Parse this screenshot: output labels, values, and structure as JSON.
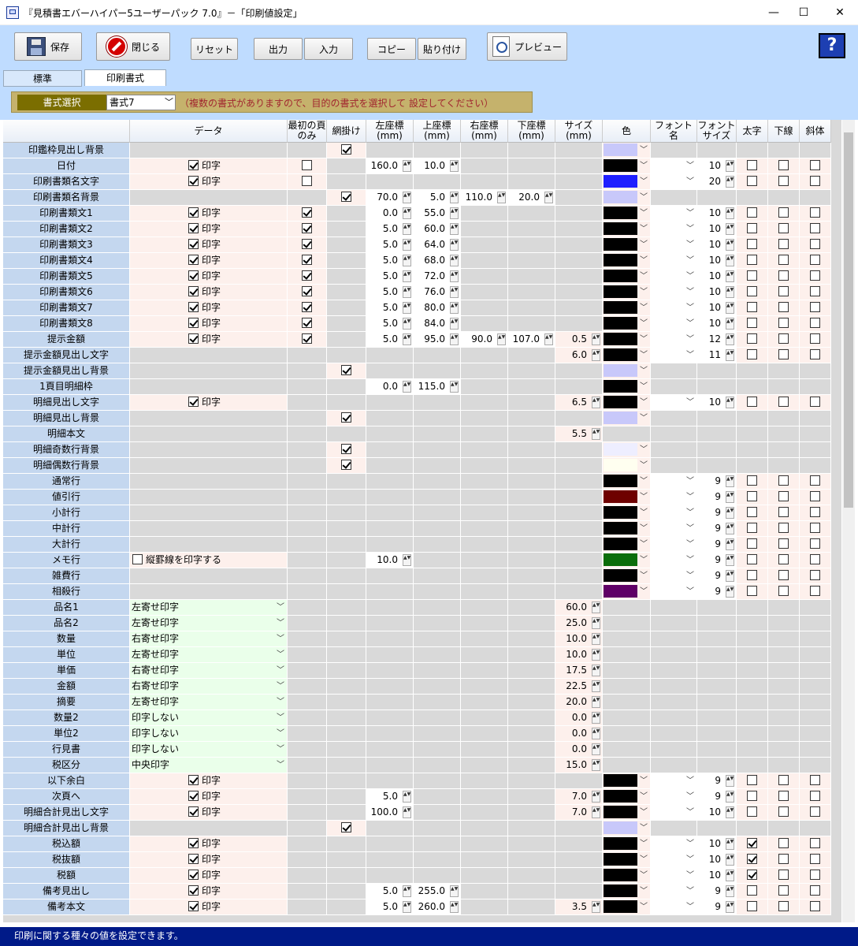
{
  "window": {
    "title": "『見積書エバーハイパー5ユーザーパック 7.0』－「印刷値設定」",
    "minimize": "—",
    "maximize": "☐",
    "close": "✕"
  },
  "toolbar": {
    "save": "保存",
    "close": "閉じる",
    "reset": "リセット",
    "output": "出力",
    "input": "入力",
    "copy": "コピー",
    "paste": "貼り付け",
    "preview": "プレビュー",
    "help": "?"
  },
  "tabs": [
    {
      "label": "標準"
    },
    {
      "label": "印刷書式"
    }
  ],
  "format": {
    "label": "書式選択",
    "selected": "書式7",
    "note": "（複数の書式がありますので、目的の書式を選択して 設定してください）"
  },
  "colors": {
    "black": "#000000",
    "blue": "#1f1fff",
    "lavender": "#c8c8fa",
    "maroon": "#6e0000",
    "green": "#0b6e0b",
    "purple": "#5f0066",
    "paleblue": "#eeeeff",
    "paleyellow": "#fffff0"
  },
  "headers": {
    "data": "データ",
    "first_page": "最初の頁のみ",
    "shading": "網掛け",
    "left": "左座標(mm)",
    "top": "上座標(mm)",
    "right": "右座標(mm)",
    "bottom": "下座標(mm)",
    "size": "サイズ(mm)",
    "color": "色",
    "font": "フォント名",
    "fontsize": "フォントサイズ",
    "bold": "太字",
    "underline": "下線",
    "italic": "斜体"
  },
  "grid_rows": [
    {
      "label": "印鑑枠見出し背景",
      "mode": "shade",
      "color": "lavender"
    },
    {
      "label": "日付",
      "check": "印字",
      "check_on": true,
      "first": false,
      "left": "160.0",
      "top": "10.0",
      "color": "black",
      "font": true,
      "fs": "10",
      "bold": false
    },
    {
      "label": "印刷書類名文字",
      "check": "印字",
      "check_on": true,
      "first": false,
      "color": "blue",
      "font": true,
      "fs": "20",
      "bold": false
    },
    {
      "label": "印刷書類名背景",
      "mode": "shade",
      "left": "70.0",
      "top": "5.0",
      "right": "110.0",
      "bottom": "20.0",
      "color": "lavender"
    },
    {
      "label": "印刷書類文1",
      "check": "印字",
      "check_on": true,
      "first": true,
      "left": "0.0",
      "top": "55.0",
      "color": "black",
      "font": true,
      "fs": "10",
      "bold": false
    },
    {
      "label": "印刷書類文2",
      "check": "印字",
      "check_on": true,
      "first": true,
      "left": "5.0",
      "top": "60.0",
      "color": "black",
      "font": true,
      "fs": "10",
      "bold": false
    },
    {
      "label": "印刷書類文3",
      "check": "印字",
      "check_on": true,
      "first": true,
      "left": "5.0",
      "top": "64.0",
      "color": "black",
      "font": true,
      "fs": "10",
      "bold": false
    },
    {
      "label": "印刷書類文4",
      "check": "印字",
      "check_on": true,
      "first": true,
      "left": "5.0",
      "top": "68.0",
      "color": "black",
      "font": true,
      "fs": "10",
      "bold": false
    },
    {
      "label": "印刷書類文5",
      "check": "印字",
      "check_on": true,
      "first": true,
      "left": "5.0",
      "top": "72.0",
      "color": "black",
      "font": true,
      "fs": "10",
      "bold": false
    },
    {
      "label": "印刷書類文6",
      "check": "印字",
      "check_on": true,
      "first": true,
      "left": "5.0",
      "top": "76.0",
      "color": "black",
      "font": true,
      "fs": "10",
      "bold": false
    },
    {
      "label": "印刷書類文7",
      "check": "印字",
      "check_on": true,
      "first": true,
      "left": "5.0",
      "top": "80.0",
      "color": "black",
      "font": true,
      "fs": "10",
      "bold": false
    },
    {
      "label": "印刷書類文8",
      "check": "印字",
      "check_on": true,
      "first": true,
      "left": "5.0",
      "top": "84.0",
      "color": "black",
      "font": true,
      "fs": "10",
      "bold": false
    },
    {
      "label": "提示金額",
      "check": "印字",
      "check_on": true,
      "first": true,
      "left": "5.0",
      "top": "95.0",
      "right": "90.0",
      "bottom": "107.0",
      "size": "0.5",
      "color": "black",
      "font": true,
      "fs": "12",
      "bold": false
    },
    {
      "label": "提示金額見出し文字",
      "size": "6.0",
      "color": "black",
      "font": true,
      "fs": "11",
      "bold": false
    },
    {
      "label": "提示金額見出し背景",
      "mode": "shade",
      "color": "lavender"
    },
    {
      "label": "1頁目明細枠",
      "left": "0.0",
      "top": "115.0",
      "color": "black"
    },
    {
      "label": "明細見出し文字",
      "check": "印字",
      "check_on": true,
      "size": "6.5",
      "color": "black",
      "font": true,
      "fs": "10",
      "bold": false
    },
    {
      "label": "明細見出し背景",
      "mode": "shade",
      "color": "lavender"
    },
    {
      "label": "明細本文",
      "size": "5.5",
      "color": "none"
    },
    {
      "label": "明細奇数行背景",
      "mode": "shade",
      "color": "paleblue"
    },
    {
      "label": "明細偶数行背景",
      "mode": "shade",
      "color": "paleyellow"
    },
    {
      "label": "通常行",
      "color": "black",
      "font": true,
      "fs": "9",
      "bold": false
    },
    {
      "label": "値引行",
      "color": "maroon",
      "font": true,
      "fs": "9",
      "bold": false
    },
    {
      "label": "小計行",
      "color": "black",
      "font": true,
      "fs": "9",
      "bold": false
    },
    {
      "label": "中計行",
      "color": "black",
      "font": true,
      "fs": "9",
      "bold": false
    },
    {
      "label": "大計行",
      "color": "black",
      "font": true,
      "fs": "9",
      "bold": false
    },
    {
      "label": "メモ行",
      "check": "縦罫線を印字する",
      "check_on": false,
      "left": "10.0",
      "color": "green",
      "font": true,
      "fs": "9",
      "bold": false
    },
    {
      "label": "雑費行",
      "color": "black",
      "font": true,
      "fs": "9",
      "bold": false
    },
    {
      "label": "相殺行",
      "color": "purple",
      "font": true,
      "fs": "9",
      "bold": false
    },
    {
      "label": "品名1",
      "select": "左寄せ印字",
      "size": "60.0"
    },
    {
      "label": "品名2",
      "select": "左寄せ印字",
      "size": "25.0"
    },
    {
      "label": "数量",
      "select": "右寄せ印字",
      "size": "10.0"
    },
    {
      "label": "単位",
      "select": "左寄せ印字",
      "size": "10.0"
    },
    {
      "label": "単価",
      "select": "右寄せ印字",
      "size": "17.5"
    },
    {
      "label": "金額",
      "select": "右寄せ印字",
      "size": "22.5"
    },
    {
      "label": "摘要",
      "select": "左寄せ印字",
      "size": "20.0"
    },
    {
      "label": "数量2",
      "select": "印字しない",
      "size": "0.0"
    },
    {
      "label": "単位2",
      "select": "印字しない",
      "size": "0.0"
    },
    {
      "label": "行見書",
      "select": "印字しない",
      "size": "0.0"
    },
    {
      "label": "税区分",
      "select": "中央印字",
      "size": "15.0"
    },
    {
      "label": "以下余白",
      "check": "印字",
      "check_on": true,
      "color": "black",
      "font": true,
      "fs": "9",
      "bold": false
    },
    {
      "label": "次頁へ",
      "check": "印字",
      "check_on": true,
      "left": "5.0",
      "size": "7.0",
      "color": "black",
      "font": true,
      "fs": "9",
      "bold": false
    },
    {
      "label": "明細合計見出し文字",
      "check": "印字",
      "check_on": true,
      "left": "100.0",
      "size": "7.0",
      "color": "black",
      "font": true,
      "fs": "10",
      "bold": false
    },
    {
      "label": "明細合計見出し背景",
      "mode": "shade",
      "color": "lavender"
    },
    {
      "label": "税込額",
      "check": "印字",
      "check_on": true,
      "color": "black",
      "font": true,
      "fs": "10",
      "bold": true
    },
    {
      "label": "税抜額",
      "check": "印字",
      "check_on": true,
      "color": "black",
      "font": true,
      "fs": "10",
      "bold": true
    },
    {
      "label": "税額",
      "check": "印字",
      "check_on": true,
      "color": "black",
      "font": true,
      "fs": "10",
      "bold": true
    },
    {
      "label": "備考見出し",
      "check": "印字",
      "check_on": true,
      "left": "5.0",
      "top": "255.0",
      "color": "black",
      "font": true,
      "fs": "9",
      "bold": false
    },
    {
      "label": "備考本文",
      "check": "印字",
      "check_on": true,
      "left": "5.0",
      "top": "260.0",
      "size": "3.5",
      "color": "black",
      "font": true,
      "fs": "9",
      "bold": false
    }
  ],
  "status": "印刷に関する種々の値を設定できます。"
}
